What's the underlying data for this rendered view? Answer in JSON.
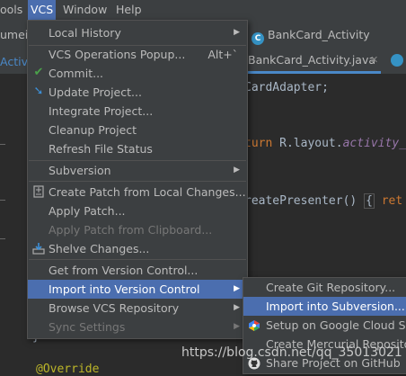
{
  "menubar": {
    "items": [
      "ools",
      "VCS",
      "Window",
      "Help"
    ]
  },
  "tabs": {
    "breadcrumb_file": "BankCard_Activity",
    "active_tab": "BankCard_Activity.java",
    "left_frag_1": "umei",
    "left_frag_2": "Activit"
  },
  "code": {
    "line1": "CardAdapter;",
    "line2_kw": "turn",
    "line2_rest": " R.layout.",
    "line2_field": "activity_",
    "line3": "reatePresenter()",
    "line3_brace": "{",
    "line3_kw": "ret",
    "line4": "@Override",
    "left_brace": "}"
  },
  "vcs_menu": {
    "items": [
      {
        "label": "Local History",
        "submenu": true,
        "icon": "",
        "state": "normal"
      },
      {
        "label": "VCS Operations Popup...",
        "shortcut": "Alt+`",
        "icon": "",
        "state": "normal"
      },
      {
        "label": "Commit...",
        "icon": "check-icon",
        "state": "normal"
      },
      {
        "label": "Update Project...",
        "icon": "update-arrow-icon",
        "state": "normal"
      },
      {
        "label": "Integrate Project...",
        "icon": "",
        "state": "normal"
      },
      {
        "label": "Cleanup Project",
        "icon": "",
        "state": "normal"
      },
      {
        "label": "Refresh File Status",
        "icon": "",
        "state": "normal"
      },
      {
        "label": "Subversion",
        "submenu": true,
        "icon": "",
        "state": "normal"
      },
      {
        "label": "Create Patch from Local Changes...",
        "icon": "patch-icon",
        "state": "normal"
      },
      {
        "label": "Apply Patch...",
        "icon": "",
        "state": "normal"
      },
      {
        "label": "Apply Patch from Clipboard...",
        "icon": "",
        "state": "disabled"
      },
      {
        "label": "Shelve Changes...",
        "icon": "shelve-icon",
        "state": "normal"
      },
      {
        "label": "Get from Version Control...",
        "icon": "",
        "state": "normal"
      },
      {
        "label": "Import into Version Control",
        "submenu": true,
        "icon": "",
        "state": "active"
      },
      {
        "label": "Browse VCS Repository",
        "submenu": true,
        "icon": "",
        "state": "normal"
      },
      {
        "label": "Sync Settings",
        "submenu": true,
        "icon": "",
        "state": "disabled"
      }
    ]
  },
  "import_submenu": {
    "items": [
      {
        "label": "Create Git Repository...",
        "icon": "",
        "state": "normal"
      },
      {
        "label": "Import into Subversion...",
        "icon": "",
        "state": "active"
      },
      {
        "label": "Setup on Google Cloud Source Repositories",
        "icon": "google-cloud-icon",
        "state": "normal"
      },
      {
        "label": "Create Mercurial Repository",
        "icon": "",
        "state": "normal"
      },
      {
        "label": "Share Project on GitHub",
        "icon": "github-icon",
        "state": "normal"
      }
    ]
  },
  "watermark": "https://blog.csdn.net/qq_35013021",
  "colors": {
    "accent": "#4b6eaf",
    "check": "#4aa14a",
    "update_arrow": "#3d8fd6"
  }
}
